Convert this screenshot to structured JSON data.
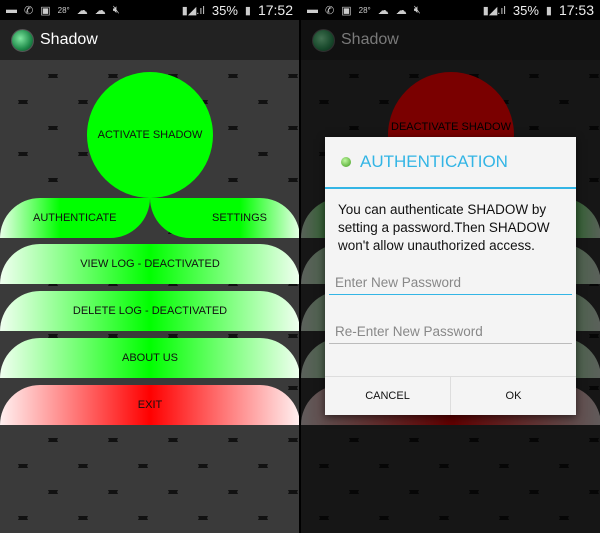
{
  "screens": [
    {
      "status": {
        "icons": [
          "message-icon",
          "viber-icon",
          "gallery-icon",
          "weather-icon",
          "cloud-icon",
          "cloud-icon",
          "mute-icon",
          "hspa-icon",
          "sim-icon",
          "signal-icon",
          "signal-icon"
        ],
        "temp": "28°",
        "battery": "35%",
        "time": "17:52"
      },
      "app_title": "Shadow",
      "logo_text": "SHADOW",
      "main": {
        "activate": "ACTIVATE SHADOW",
        "authenticate": "AUTHENTICATE",
        "settings": "SETTINGS",
        "view_log": "VIEW LOG - DEACTIVATED",
        "delete_log": "DELETE LOG - DEACTIVATED",
        "about": "ABOUT US",
        "exit": "EXIT"
      }
    },
    {
      "status": {
        "temp": "28°",
        "battery": "35%",
        "time": "17:53"
      },
      "app_title": "Shadow",
      "logo_text": "SHADOW",
      "main": {
        "deactivate": "DEACTIVATE SHADOW"
      },
      "dialog": {
        "title": "AUTHENTICATION",
        "message": "You can authenticate SHADOW by setting a password.Then SHADOW won't allow unauthorized access.",
        "password_placeholder": "Enter New Password",
        "confirm_placeholder": "Re-Enter New Password",
        "cancel": "CANCEL",
        "ok": "OK"
      }
    }
  ],
  "colors": {
    "active": "#00ff00",
    "exit": "#ff0000",
    "deactivate": "#6b0000",
    "accent": "#33b5e5"
  }
}
